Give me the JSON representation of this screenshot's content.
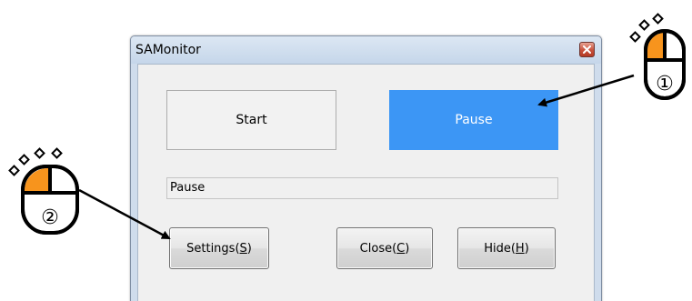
{
  "window": {
    "title": "SAMonitor",
    "close_icon": "close-x-icon"
  },
  "toggle": {
    "start_label": "Start",
    "pause_label": "Pause",
    "active": "pause",
    "active_color": "#3c96f5"
  },
  "status": {
    "value": "Pause"
  },
  "buttons": {
    "settings": {
      "text": "Settings(",
      "mnemonic": "S",
      "suffix": ")"
    },
    "close": {
      "text": "Close(",
      "mnemonic": "C",
      "suffix": ")"
    },
    "hide": {
      "text": "Hide(",
      "mnemonic": "H",
      "suffix": ")"
    }
  },
  "callouts": [
    {
      "marker": "①",
      "icon": "mouse-left-click-icon",
      "accent": "#f7941d"
    },
    {
      "marker": "②",
      "icon": "mouse-left-click-icon",
      "accent": "#f7941d"
    }
  ]
}
